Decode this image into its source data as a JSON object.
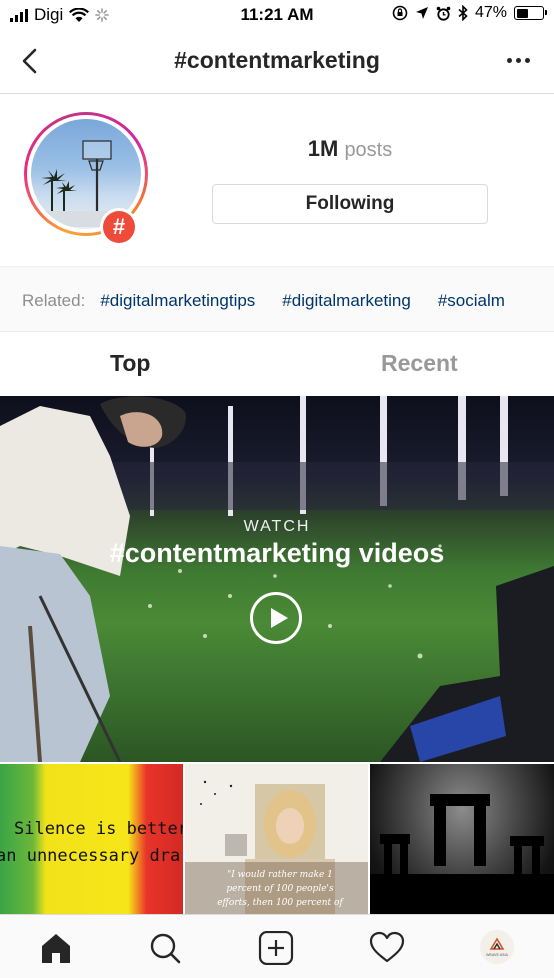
{
  "status_bar": {
    "carrier": "Digi",
    "time": "11:21 AM",
    "battery_percent_label": "47%",
    "battery_level": 0.47
  },
  "header": {
    "title": "#contentmarketing"
  },
  "profile": {
    "post_count": "1M",
    "post_label": "posts",
    "follow_label": "Following",
    "badge_symbol": "#"
  },
  "related": {
    "label": "Related:",
    "tags": [
      "#digitalmarketingtips",
      "#digitalmarketing",
      "#socialm"
    ]
  },
  "tabs": [
    {
      "label": "Top",
      "active": true
    },
    {
      "label": "Recent",
      "active": false
    }
  ],
  "video": {
    "eyebrow": "WATCH",
    "title": "#contentmarketing videos"
  },
  "grid": {
    "tile1_lines": [
      "Silence is better",
      "an unnecessary dra"
    ],
    "tile2_quote": "\"I would rather make 1 percent of 100 people's efforts, then 100 percent of"
  },
  "tabbar": {
    "items": [
      "home-icon",
      "search-icon",
      "add-post-icon",
      "heart-icon",
      "profile-avatar"
    ],
    "profile_logo_text": "WEAVE ASIA"
  },
  "colors": {
    "link": "#003569",
    "muted": "#8e8e8e",
    "badge": "#ee4b3a"
  }
}
